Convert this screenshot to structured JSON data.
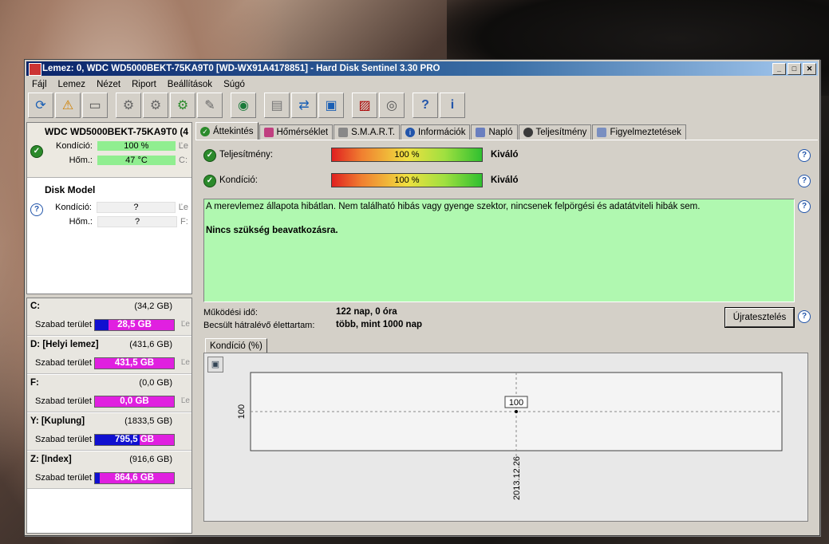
{
  "window": {
    "title": "Lemez: 0, WDC WD5000BEKT-75KA9T0 [WD-WX91A4178851]  -  Hard Disk Sentinel 3.30 PRO",
    "controls": [
      "_",
      "□",
      "✕"
    ]
  },
  "menu": [
    "Fájl",
    "Lemez",
    "Nézet",
    "Riport",
    "Beállítások",
    "Súgó"
  ],
  "disks": [
    {
      "name": "WDC WD5000BEKT-75KA9T0",
      "suffix": "(4",
      "condition_label": "Kondíció:",
      "condition": "100 %",
      "temp_label": "Hőm.:",
      "temp": "47 °C",
      "drive_hint_1": "Ľe",
      "drive_hint_2": "C:",
      "status": "ok"
    },
    {
      "name": "Disk Model",
      "suffix": "",
      "condition_label": "Kondíció:",
      "condition": "?",
      "temp_label": "Hőm.:",
      "temp": "?",
      "drive_hint_1": "Ľe",
      "drive_hint_2": "F:",
      "status": "unknown"
    }
  ],
  "volumes": [
    {
      "name": "C:",
      "size": "(34,2 GB)",
      "free_label": "Szabad terület",
      "free": "28,5 GB",
      "used_fraction": 0.17,
      "edge": "Ľe"
    },
    {
      "name": "D: [Helyi lemez]",
      "size": "(431,6 GB)",
      "free_label": "Szabad terület",
      "free": "431,5 GB",
      "used_fraction": 0.0,
      "edge": "Ľe"
    },
    {
      "name": "F:",
      "size": "(0,0 GB)",
      "free_label": "Szabad terület",
      "free": "0,0 GB",
      "used_fraction": 0.0,
      "edge": "Ľe"
    },
    {
      "name": "Y: [Kuplung]",
      "size": "(1833,5 GB)",
      "free_label": "Szabad terület",
      "free": "795,5 GB",
      "used_fraction": 0.57,
      "edge": ""
    },
    {
      "name": "Z: [Index]",
      "size": "(916,6 GB)",
      "free_label": "Szabad terület",
      "free": "864,6 GB",
      "used_fraction": 0.06,
      "edge": ""
    }
  ],
  "tabs": [
    {
      "label": "Áttekintés",
      "icon": "check-icon",
      "active": true
    },
    {
      "label": "Hőmérséklet",
      "icon": "thermometer-icon"
    },
    {
      "label": "S.M.A.R.T.",
      "icon": "disk-icon"
    },
    {
      "label": "Információk",
      "icon": "info-icon"
    },
    {
      "label": "Napló",
      "icon": "log-icon"
    },
    {
      "label": "Teljesítmény",
      "icon": "performance-icon"
    },
    {
      "label": "Figyelmeztetések",
      "icon": "alerts-icon"
    }
  ],
  "overview": {
    "performance_label": "Teljesítmény:",
    "performance_value": "100 %",
    "performance_word": "Kiváló",
    "condition_label": "Kondíció:",
    "condition_value": "100 %",
    "condition_word": "Kiváló",
    "message": "A merevlemez állapota hibátlan. Nem található hibás vagy gyenge szektor, nincsenek felpörgési és adatátviteli hibák sem.",
    "recommendation": "Nincs szükség beavatkozásra.",
    "uptime_label": "Működési idő:",
    "uptime_value": "122 nap, 0 óra",
    "lifetime_label": "Becsült hátralévő élettartam:",
    "lifetime_value": "több, mint 1000 nap",
    "retest_button": "Újratesztelés",
    "chart_tab": "Kondíció  (%)"
  },
  "chart_data": {
    "type": "line",
    "title": "",
    "x": [
      "2013.12.26"
    ],
    "series": [
      {
        "values": [
          100
        ]
      }
    ],
    "y_tick_label": "100",
    "data_labels": [
      "100"
    ]
  },
  "colors": {
    "accent_title": "#0a246a",
    "good": "#90ee90",
    "message_bg": "#b0f8b0",
    "free_bar": "#e020e0",
    "used_bar": "#1010d0"
  }
}
